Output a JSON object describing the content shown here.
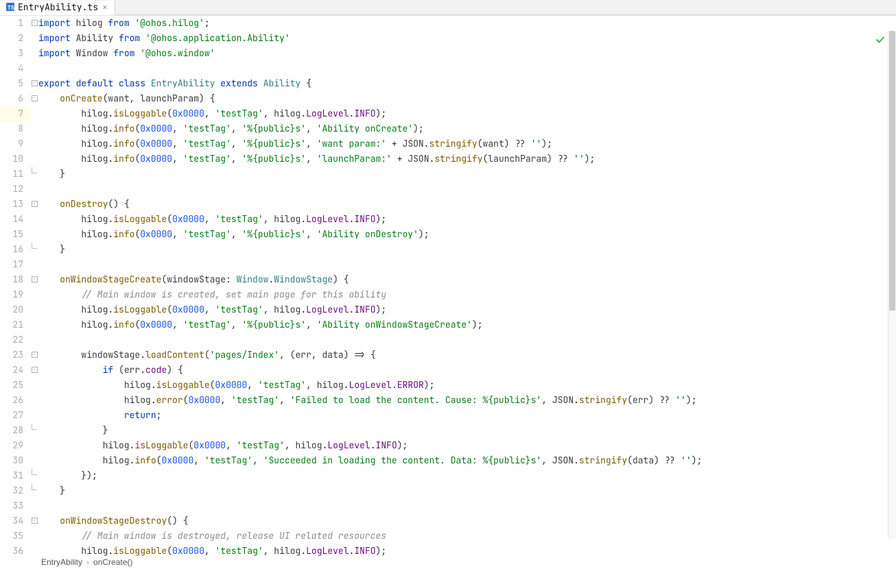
{
  "tab": {
    "filename": "EntryAbility.ts",
    "close": "×"
  },
  "breadcrumb": {
    "a": "EntryAbility",
    "b": "onCreate()"
  },
  "status_icon": "check",
  "highlighted_line": 7,
  "code": [
    {
      "n": 1,
      "fold": "minus",
      "tokens": [
        [
          "kw",
          "import"
        ],
        [
          "id",
          " hilog "
        ],
        [
          "kw",
          "from"
        ],
        [
          "id",
          " "
        ],
        [
          "str",
          "'@ohos.hilog'"
        ],
        [
          "punc",
          ";"
        ]
      ]
    },
    {
      "n": 2,
      "fold": "",
      "tokens": [
        [
          "kw",
          "import"
        ],
        [
          "id",
          " Ability "
        ],
        [
          "kw",
          "from"
        ],
        [
          "id",
          " "
        ],
        [
          "str",
          "'@ohos.application.Ability'"
        ]
      ]
    },
    {
      "n": 3,
      "fold": "",
      "tokens": [
        [
          "kw",
          "import"
        ],
        [
          "id",
          " Window "
        ],
        [
          "kw",
          "from"
        ],
        [
          "id",
          " "
        ],
        [
          "str",
          "'@ohos.window'"
        ]
      ]
    },
    {
      "n": 4,
      "fold": "",
      "tokens": []
    },
    {
      "n": 5,
      "fold": "minus",
      "tokens": [
        [
          "kw",
          "export default class"
        ],
        [
          "id",
          " "
        ],
        [
          "cls",
          "EntryAbility"
        ],
        [
          "id",
          " "
        ],
        [
          "kw",
          "extends"
        ],
        [
          "id",
          " "
        ],
        [
          "cls",
          "Ability"
        ],
        [
          "id",
          " "
        ],
        [
          "punc",
          "{"
        ]
      ]
    },
    {
      "n": 6,
      "fold": "minus",
      "indent": 1,
      "tokens": [
        [
          "fn",
          "onCreate"
        ],
        [
          "punc",
          "("
        ],
        [
          "par",
          "want"
        ],
        [
          "punc",
          ", "
        ],
        [
          "par",
          "launchParam"
        ],
        [
          "punc",
          ") {"
        ]
      ]
    },
    {
      "n": 7,
      "fold": "",
      "indent": 2,
      "hl": true,
      "tokens": [
        [
          "id",
          "hilog"
        ],
        [
          "punc",
          "."
        ],
        [
          "fn",
          "isLoggable"
        ],
        [
          "punc",
          "("
        ],
        [
          "num",
          "0x0000"
        ],
        [
          "punc",
          ", "
        ],
        [
          "str",
          "'testTag'"
        ],
        [
          "punc",
          ", "
        ],
        [
          "id",
          "hilog"
        ],
        [
          "punc",
          "."
        ],
        [
          "obj",
          "LogLevel"
        ],
        [
          "punc",
          "."
        ],
        [
          "obj",
          "INFO"
        ],
        [
          "punc",
          ");"
        ]
      ]
    },
    {
      "n": 8,
      "fold": "",
      "indent": 2,
      "tokens": [
        [
          "id",
          "hilog"
        ],
        [
          "punc",
          "."
        ],
        [
          "fn",
          "info"
        ],
        [
          "punc",
          "("
        ],
        [
          "num",
          "0x0000"
        ],
        [
          "punc",
          ", "
        ],
        [
          "str",
          "'testTag'"
        ],
        [
          "punc",
          ", "
        ],
        [
          "str",
          "'%{public}s'"
        ],
        [
          "punc",
          ", "
        ],
        [
          "str",
          "'Ability onCreate'"
        ],
        [
          "punc",
          ");"
        ]
      ]
    },
    {
      "n": 9,
      "fold": "",
      "indent": 2,
      "tokens": [
        [
          "id",
          "hilog"
        ],
        [
          "punc",
          "."
        ],
        [
          "fn",
          "info"
        ],
        [
          "punc",
          "("
        ],
        [
          "num",
          "0x0000"
        ],
        [
          "punc",
          ", "
        ],
        [
          "str",
          "'testTag'"
        ],
        [
          "punc",
          ", "
        ],
        [
          "str",
          "'%{public}s'"
        ],
        [
          "punc",
          ", "
        ],
        [
          "str",
          "'want param:'"
        ],
        [
          "punc",
          " + "
        ],
        [
          "glb",
          "JSON"
        ],
        [
          "punc",
          "."
        ],
        [
          "fn",
          "stringify"
        ],
        [
          "punc",
          "("
        ],
        [
          "par",
          "want"
        ],
        [
          "punc",
          ") ?? "
        ],
        [
          "str",
          "''"
        ],
        [
          "punc",
          ");"
        ]
      ]
    },
    {
      "n": 10,
      "fold": "",
      "indent": 2,
      "tokens": [
        [
          "id",
          "hilog"
        ],
        [
          "punc",
          "."
        ],
        [
          "fn",
          "info"
        ],
        [
          "punc",
          "("
        ],
        [
          "num",
          "0x0000"
        ],
        [
          "punc",
          ", "
        ],
        [
          "str",
          "'testTag'"
        ],
        [
          "punc",
          ", "
        ],
        [
          "str",
          "'%{public}s'"
        ],
        [
          "punc",
          ", "
        ],
        [
          "str",
          "'launchParam:'"
        ],
        [
          "punc",
          " + "
        ],
        [
          "glb",
          "JSON"
        ],
        [
          "punc",
          "."
        ],
        [
          "fn",
          "stringify"
        ],
        [
          "punc",
          "("
        ],
        [
          "par",
          "launchParam"
        ],
        [
          "punc",
          ") ?? "
        ],
        [
          "str",
          "''"
        ],
        [
          "punc",
          ");"
        ]
      ]
    },
    {
      "n": 11,
      "fold": "end",
      "indent": 1,
      "tokens": [
        [
          "punc",
          "}"
        ]
      ]
    },
    {
      "n": 12,
      "fold": "",
      "tokens": []
    },
    {
      "n": 13,
      "fold": "minus",
      "indent": 1,
      "tokens": [
        [
          "fn",
          "onDestroy"
        ],
        [
          "punc",
          "() {"
        ]
      ]
    },
    {
      "n": 14,
      "fold": "",
      "indent": 2,
      "tokens": [
        [
          "id",
          "hilog"
        ],
        [
          "punc",
          "."
        ],
        [
          "fn",
          "isLoggable"
        ],
        [
          "punc",
          "("
        ],
        [
          "num",
          "0x0000"
        ],
        [
          "punc",
          ", "
        ],
        [
          "str",
          "'testTag'"
        ],
        [
          "punc",
          ", "
        ],
        [
          "id",
          "hilog"
        ],
        [
          "punc",
          "."
        ],
        [
          "obj",
          "LogLevel"
        ],
        [
          "punc",
          "."
        ],
        [
          "obj",
          "INFO"
        ],
        [
          "punc",
          ");"
        ]
      ]
    },
    {
      "n": 15,
      "fold": "",
      "indent": 2,
      "tokens": [
        [
          "id",
          "hilog"
        ],
        [
          "punc",
          "."
        ],
        [
          "fn",
          "info"
        ],
        [
          "punc",
          "("
        ],
        [
          "num",
          "0x0000"
        ],
        [
          "punc",
          ", "
        ],
        [
          "str",
          "'testTag'"
        ],
        [
          "punc",
          ", "
        ],
        [
          "str",
          "'%{public}s'"
        ],
        [
          "punc",
          ", "
        ],
        [
          "str",
          "'Ability onDestroy'"
        ],
        [
          "punc",
          ");"
        ]
      ]
    },
    {
      "n": 16,
      "fold": "end",
      "indent": 1,
      "tokens": [
        [
          "punc",
          "}"
        ]
      ]
    },
    {
      "n": 17,
      "fold": "",
      "tokens": []
    },
    {
      "n": 18,
      "fold": "minus",
      "indent": 1,
      "tokens": [
        [
          "fn",
          "onWindowStageCreate"
        ],
        [
          "punc",
          "("
        ],
        [
          "par",
          "windowStage"
        ],
        [
          "punc",
          ": "
        ],
        [
          "cls",
          "Window"
        ],
        [
          "punc",
          "."
        ],
        [
          "cls",
          "WindowStage"
        ],
        [
          "punc",
          ") {"
        ]
      ]
    },
    {
      "n": 19,
      "fold": "",
      "indent": 2,
      "tokens": [
        [
          "cmt",
          "// Main window is created, set main page for this ability"
        ]
      ]
    },
    {
      "n": 20,
      "fold": "",
      "indent": 2,
      "tokens": [
        [
          "id",
          "hilog"
        ],
        [
          "punc",
          "."
        ],
        [
          "fn",
          "isLoggable"
        ],
        [
          "punc",
          "("
        ],
        [
          "num",
          "0x0000"
        ],
        [
          "punc",
          ", "
        ],
        [
          "str",
          "'testTag'"
        ],
        [
          "punc",
          ", "
        ],
        [
          "id",
          "hilog"
        ],
        [
          "punc",
          "."
        ],
        [
          "obj",
          "LogLevel"
        ],
        [
          "punc",
          "."
        ],
        [
          "obj",
          "INFO"
        ],
        [
          "punc",
          ");"
        ]
      ]
    },
    {
      "n": 21,
      "fold": "",
      "indent": 2,
      "tokens": [
        [
          "id",
          "hilog"
        ],
        [
          "punc",
          "."
        ],
        [
          "fn",
          "info"
        ],
        [
          "punc",
          "("
        ],
        [
          "num",
          "0x0000"
        ],
        [
          "punc",
          ", "
        ],
        [
          "str",
          "'testTag'"
        ],
        [
          "punc",
          ", "
        ],
        [
          "str",
          "'%{public}s'"
        ],
        [
          "punc",
          ", "
        ],
        [
          "str",
          "'Ability onWindowStageCreate'"
        ],
        [
          "punc",
          ");"
        ]
      ]
    },
    {
      "n": 22,
      "fold": "",
      "tokens": []
    },
    {
      "n": 23,
      "fold": "minus",
      "indent": 2,
      "tokens": [
        [
          "par",
          "windowStage"
        ],
        [
          "punc",
          "."
        ],
        [
          "fn",
          "loadContent"
        ],
        [
          "punc",
          "("
        ],
        [
          "str",
          "'pages/Index'"
        ],
        [
          "punc",
          ", ("
        ],
        [
          "par",
          "err"
        ],
        [
          "punc",
          ", "
        ],
        [
          "par",
          "data"
        ],
        [
          "punc",
          ") => {"
        ]
      ]
    },
    {
      "n": 24,
      "fold": "minus",
      "indent": 3,
      "tokens": [
        [
          "kw",
          "if"
        ],
        [
          "punc",
          " ("
        ],
        [
          "par",
          "err"
        ],
        [
          "punc",
          "."
        ],
        [
          "obj",
          "code"
        ],
        [
          "punc",
          ") {"
        ]
      ]
    },
    {
      "n": 25,
      "fold": "",
      "indent": 4,
      "tokens": [
        [
          "id",
          "hilog"
        ],
        [
          "punc",
          "."
        ],
        [
          "fn",
          "isLoggable"
        ],
        [
          "punc",
          "("
        ],
        [
          "num",
          "0x0000"
        ],
        [
          "punc",
          ", "
        ],
        [
          "str",
          "'testTag'"
        ],
        [
          "punc",
          ", "
        ],
        [
          "id",
          "hilog"
        ],
        [
          "punc",
          "."
        ],
        [
          "obj",
          "LogLevel"
        ],
        [
          "punc",
          "."
        ],
        [
          "obj",
          "ERROR"
        ],
        [
          "punc",
          ");"
        ]
      ]
    },
    {
      "n": 26,
      "fold": "",
      "indent": 4,
      "tokens": [
        [
          "id",
          "hilog"
        ],
        [
          "punc",
          "."
        ],
        [
          "fn",
          "error"
        ],
        [
          "punc",
          "("
        ],
        [
          "num",
          "0x0000"
        ],
        [
          "punc",
          ", "
        ],
        [
          "str",
          "'testTag'"
        ],
        [
          "punc",
          ", "
        ],
        [
          "str",
          "'Failed to load the content. Cause: %{public}s'"
        ],
        [
          "punc",
          ", "
        ],
        [
          "glb",
          "JSON"
        ],
        [
          "punc",
          "."
        ],
        [
          "fn",
          "stringify"
        ],
        [
          "punc",
          "("
        ],
        [
          "par",
          "err"
        ],
        [
          "punc",
          ") ?? "
        ],
        [
          "str",
          "''"
        ],
        [
          "punc",
          ");"
        ]
      ]
    },
    {
      "n": 27,
      "fold": "",
      "indent": 4,
      "tokens": [
        [
          "kw",
          "return"
        ],
        [
          "punc",
          ";"
        ]
      ]
    },
    {
      "n": 28,
      "fold": "end",
      "indent": 3,
      "tokens": [
        [
          "punc",
          "}"
        ]
      ]
    },
    {
      "n": 29,
      "fold": "",
      "indent": 3,
      "tokens": [
        [
          "id",
          "hilog"
        ],
        [
          "punc",
          "."
        ],
        [
          "fn",
          "isLoggable"
        ],
        [
          "punc",
          "("
        ],
        [
          "num",
          "0x0000"
        ],
        [
          "punc",
          ", "
        ],
        [
          "str",
          "'testTag'"
        ],
        [
          "punc",
          ", "
        ],
        [
          "id",
          "hilog"
        ],
        [
          "punc",
          "."
        ],
        [
          "obj",
          "LogLevel"
        ],
        [
          "punc",
          "."
        ],
        [
          "obj",
          "INFO"
        ],
        [
          "punc",
          ");"
        ]
      ]
    },
    {
      "n": 30,
      "fold": "",
      "indent": 3,
      "tokens": [
        [
          "id",
          "hilog"
        ],
        [
          "punc",
          "."
        ],
        [
          "fn",
          "info"
        ],
        [
          "punc",
          "("
        ],
        [
          "num",
          "0x0000"
        ],
        [
          "punc",
          ", "
        ],
        [
          "str",
          "'testTag'"
        ],
        [
          "punc",
          ", "
        ],
        [
          "str",
          "'Succeeded in loading the content. Data: %{public}s'"
        ],
        [
          "punc",
          ", "
        ],
        [
          "glb",
          "JSON"
        ],
        [
          "punc",
          "."
        ],
        [
          "fn",
          "stringify"
        ],
        [
          "punc",
          "("
        ],
        [
          "par",
          "data"
        ],
        [
          "punc",
          ") ?? "
        ],
        [
          "str",
          "''"
        ],
        [
          "punc",
          ");"
        ]
      ]
    },
    {
      "n": 31,
      "fold": "end",
      "indent": 2,
      "tokens": [
        [
          "punc",
          "});"
        ]
      ]
    },
    {
      "n": 32,
      "fold": "end",
      "indent": 1,
      "tokens": [
        [
          "punc",
          "}"
        ]
      ]
    },
    {
      "n": 33,
      "fold": "",
      "tokens": []
    },
    {
      "n": 34,
      "fold": "minus",
      "indent": 1,
      "tokens": [
        [
          "fn",
          "onWindowStageDestroy"
        ],
        [
          "punc",
          "() {"
        ]
      ]
    },
    {
      "n": 35,
      "fold": "",
      "indent": 2,
      "tokens": [
        [
          "cmt",
          "// Main window is destroyed, release UI related resources"
        ]
      ]
    },
    {
      "n": 36,
      "fold": "",
      "indent": 2,
      "tokens": [
        [
          "id",
          "hilog"
        ],
        [
          "punc",
          "."
        ],
        [
          "fn",
          "isLoggable"
        ],
        [
          "punc",
          "("
        ],
        [
          "num",
          "0x0000"
        ],
        [
          "punc",
          ", "
        ],
        [
          "str",
          "'testTag'"
        ],
        [
          "punc",
          ", "
        ],
        [
          "id",
          "hilog"
        ],
        [
          "punc",
          "."
        ],
        [
          "obj",
          "LogLevel"
        ],
        [
          "punc",
          "."
        ],
        [
          "obj",
          "INFO"
        ],
        [
          "punc",
          ");"
        ]
      ]
    }
  ]
}
